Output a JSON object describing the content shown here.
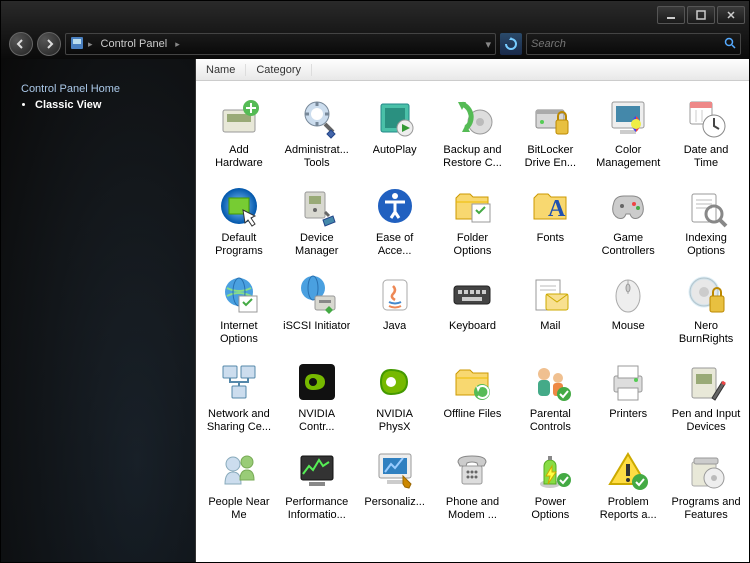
{
  "window": {
    "min": "_",
    "max": "☐",
    "close": "✕"
  },
  "toolbar": {
    "breadcrumb": "Control Panel",
    "sep": "▸",
    "search_placeholder": "Search"
  },
  "sidebar": {
    "home": "Control Panel Home",
    "classic": "Classic View"
  },
  "columns": {
    "name": "Name",
    "category": "Category"
  },
  "items": [
    {
      "id": "add-hardware",
      "label": "Add Hardware"
    },
    {
      "id": "admin-tools",
      "label": "Administrat... Tools"
    },
    {
      "id": "autoplay",
      "label": "AutoPlay"
    },
    {
      "id": "backup-restore",
      "label": "Backup and Restore C..."
    },
    {
      "id": "bitlocker",
      "label": "BitLocker Drive En..."
    },
    {
      "id": "color-management",
      "label": "Color Management"
    },
    {
      "id": "date-time",
      "label": "Date and Time"
    },
    {
      "id": "default-programs",
      "label": "Default Programs"
    },
    {
      "id": "device-manager",
      "label": "Device Manager"
    },
    {
      "id": "ease-of-access",
      "label": "Ease of Acce..."
    },
    {
      "id": "folder-options",
      "label": "Folder Options"
    },
    {
      "id": "fonts",
      "label": "Fonts"
    },
    {
      "id": "game-controllers",
      "label": "Game Controllers"
    },
    {
      "id": "indexing-options",
      "label": "Indexing Options"
    },
    {
      "id": "internet-options",
      "label": "Internet Options"
    },
    {
      "id": "iscsi",
      "label": "iSCSI Initiator"
    },
    {
      "id": "java",
      "label": "Java"
    },
    {
      "id": "keyboard",
      "label": "Keyboard"
    },
    {
      "id": "mail",
      "label": "Mail"
    },
    {
      "id": "mouse",
      "label": "Mouse"
    },
    {
      "id": "nero",
      "label": "Nero BurnRights"
    },
    {
      "id": "network-sharing",
      "label": "Network and Sharing Ce..."
    },
    {
      "id": "nvidia-control",
      "label": "NVIDIA Contr..."
    },
    {
      "id": "nvidia-physx",
      "label": "NVIDIA PhysX"
    },
    {
      "id": "offline-files",
      "label": "Offline Files"
    },
    {
      "id": "parental-controls",
      "label": "Parental Controls"
    },
    {
      "id": "printers",
      "label": "Printers"
    },
    {
      "id": "pen-input",
      "label": "Pen and Input Devices"
    },
    {
      "id": "people-near-me",
      "label": "People Near Me"
    },
    {
      "id": "performance-info",
      "label": "Performance Informatio..."
    },
    {
      "id": "personalization",
      "label": "Personaliz..."
    },
    {
      "id": "phone-modem",
      "label": "Phone and Modem ..."
    },
    {
      "id": "power-options",
      "label": "Power Options"
    },
    {
      "id": "problem-reports",
      "label": "Problem Reports a..."
    },
    {
      "id": "programs-features",
      "label": "Programs and Features"
    }
  ]
}
